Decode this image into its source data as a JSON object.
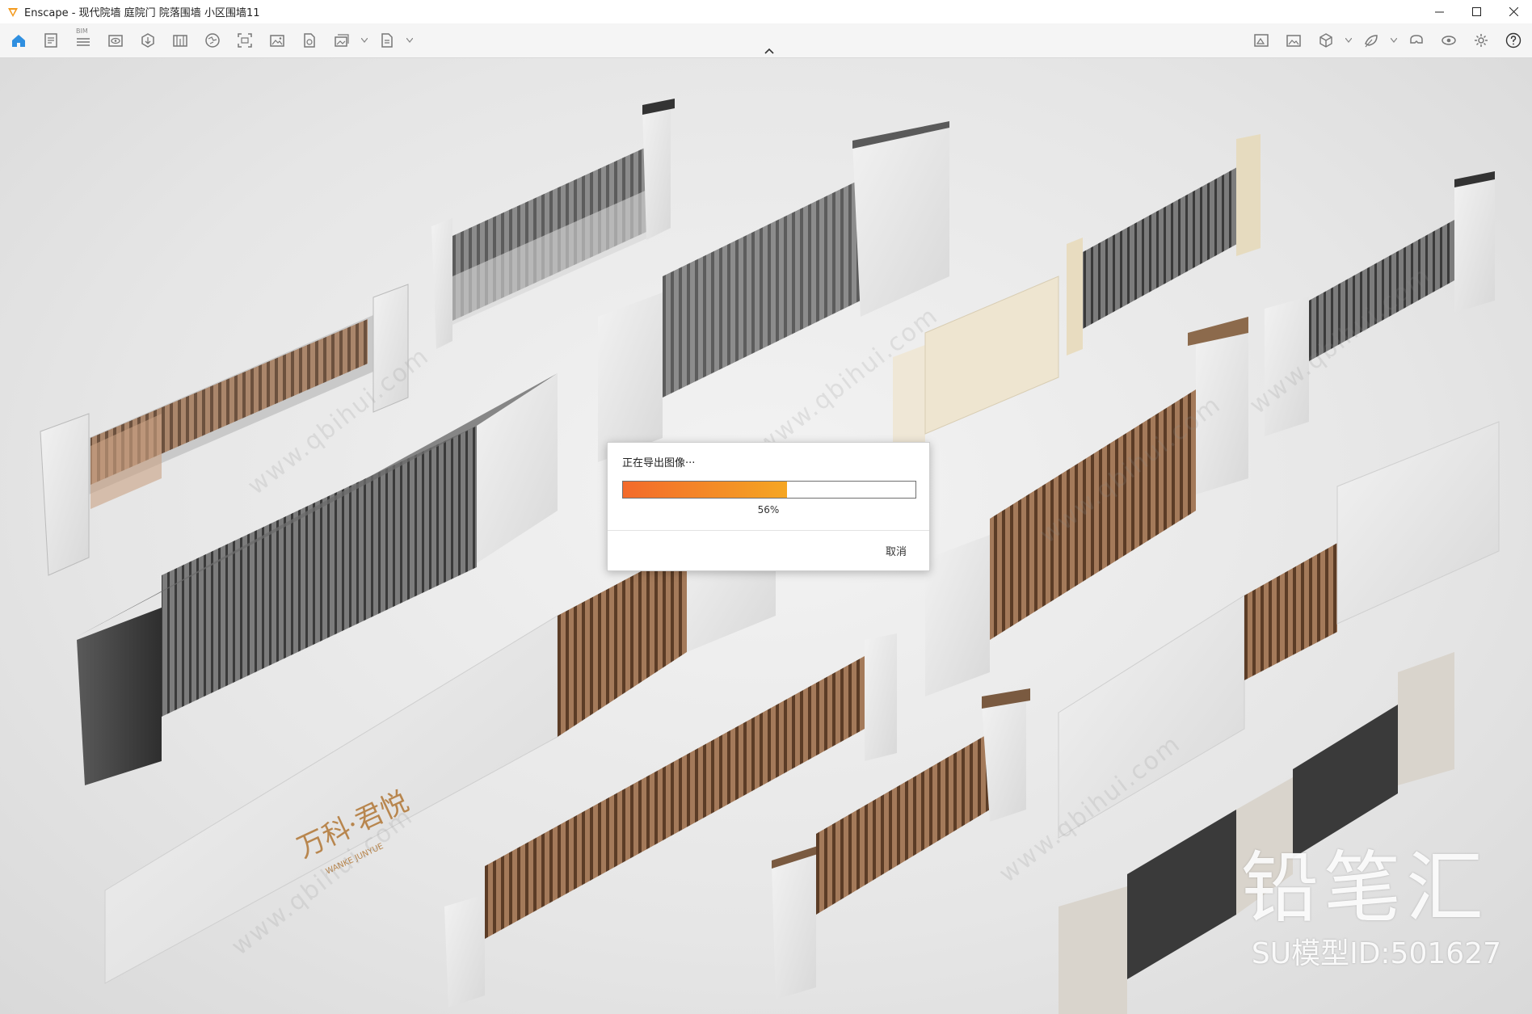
{
  "window": {
    "title": "Enscape - 现代院墙 庭院门 院落围墙 小区围墙11",
    "icons": [
      "enscape-logo-icon",
      "minimize-icon",
      "maximize-icon",
      "close-icon"
    ]
  },
  "toolbar": {
    "bim_label": "BIM",
    "left_icons": [
      "home-icon",
      "notes-icon",
      "bim-icon",
      "visibility-icon",
      "navigation-icon",
      "materials-icon",
      "site-context-icon",
      "capture-icon",
      "screenshot-icon",
      "export-icon",
      "batch-render-icon",
      "exe-export-icon"
    ],
    "right_icons": [
      "asset-library-icon",
      "image-gallery-icon",
      "views-icon",
      "atmosphere-icon",
      "vr-headset-icon",
      "preview-icon",
      "settings-icon",
      "help-icon"
    ]
  },
  "dialog": {
    "title": "正在导出图像···",
    "progress": 0.56,
    "progress_label": "56%",
    "cancel_label": "取消",
    "progress_colors": {
      "start": "#f36a2b",
      "end": "#f5a623"
    }
  },
  "watermark": {
    "url_text": "www.qbihui.com",
    "brand_text": "铅笔汇",
    "model_id": "SU模型ID:501627"
  },
  "scene": {
    "sign_text": "万科·君悦",
    "sign_subtext": "WANKE JUNYUE"
  }
}
